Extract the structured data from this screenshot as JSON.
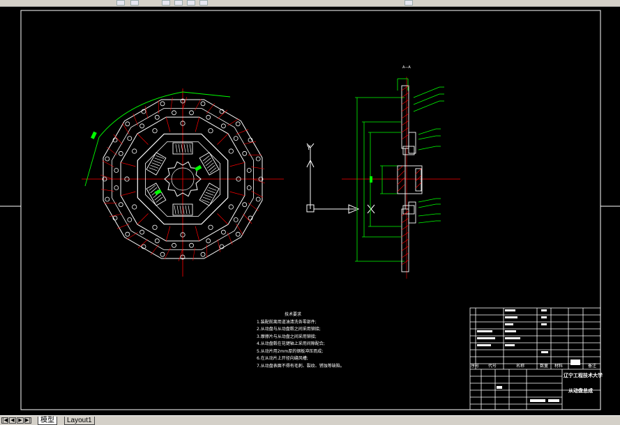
{
  "tabs": [
    {
      "label": "模型"
    },
    {
      "label": "Layout1"
    }
  ],
  "drawing": {
    "view_label": "A—A",
    "ucs": {
      "y": "Y",
      "x": "X"
    }
  },
  "notes": {
    "title": "技术要求",
    "lines": [
      "1.装配前离用道油清洗各零部件;",
      "2.从动盘与从动盘毂之间采用铆接;",
      "3.摩擦片与从动盘之间采用铆接;",
      "4.从动盘毂在花键轴上采用间隙配合;",
      "5.从动片用2mm厚的钢板冲压而成;",
      "6.在从动片上开径向缝风槽;",
      "7.从动盘表面不得有毛刺、裂纹、锈蚀等缺陷。"
    ]
  },
  "title_block": {
    "school": "辽宁工程技术大学",
    "drawing_name": "从动盘总成",
    "col_labels": [
      "序号",
      "代号",
      "名称",
      "数量",
      "材料",
      "备注"
    ]
  },
  "colors": {
    "background": "#000000",
    "red": "#ff0000",
    "green": "#00ff00",
    "white": "#ffffff",
    "yellow": "#ffff00"
  }
}
